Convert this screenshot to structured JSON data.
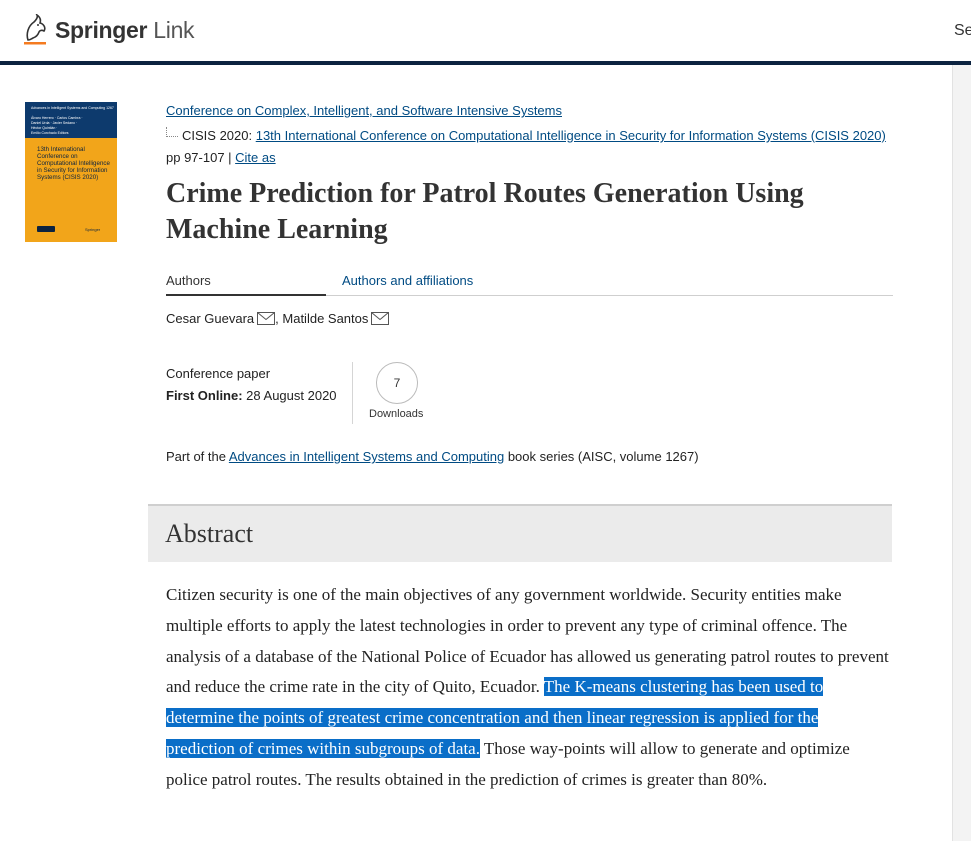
{
  "header": {
    "logo": {
      "brand": "Springer",
      "product": "Link"
    },
    "cut_text": "Se"
  },
  "cover": {
    "series_line": "Advances in Intelligent Systems and Computing 1267",
    "editors": [
      "Álvaro Herrero · Carlos Cambra ·",
      "Daniel Urda · Javier Sedano ·",
      "Héctor Quintián ·",
      "Emilio Corchado  Editors"
    ],
    "title": "13th International Conference on Computational Intelligence in Security for Information Systems (CISIS 2020)",
    "publisher": "Springer"
  },
  "breadcrumb": {
    "conference": "Conference on Complex, Intelligent, and Software Intensive Systems",
    "proceedings_prefix": "CISIS 2020: ",
    "proceedings_link": "13th International Conference on Computational Intelligence in Security for Information Systems (CISIS 2020)",
    "pages": " pp 97-107 | ",
    "cite_as": "Cite as"
  },
  "title": "Crime Prediction for Patrol Routes Generation Using Machine Learning",
  "tabs": [
    {
      "label": "Authors",
      "active": true
    },
    {
      "label": "Authors and affiliations",
      "active": false
    }
  ],
  "authors": [
    {
      "name": "Cesar Guevara"
    },
    {
      "name": "Matilde Santos"
    }
  ],
  "meta": {
    "type": "Conference paper",
    "first_online_label": "First Online:",
    "first_online_value": " 28 August 2020",
    "downloads_count": "7",
    "downloads_label": "Downloads"
  },
  "series": {
    "prefix": "Part of the ",
    "link": "Advances in Intelligent Systems and Computing",
    "suffix": " book series (AISC, volume 1267)"
  },
  "abstract": {
    "heading": "Abstract",
    "text_before": "Citizen security is one of the main objectives of any government worldwide. Security entities make multiple efforts to apply the latest technologies in order to prevent any type of criminal offence. The analysis of a database of the National Police of Ecuador has allowed us generating patrol routes to prevent and reduce the crime rate in the city of Quito, Ecuador. ",
    "text_highlighted": "The K-means clustering has been used to determine the points of greatest crime concentration and then linear regression is applied for the prediction of crimes within subgroups of data.",
    "text_after": " Those way-points will allow to generate and optimize police patrol routes. The results obtained in the prediction of crimes is greater than 80%."
  },
  "colors": {
    "link": "#004b83",
    "navy_rule": "#0c2340",
    "highlight": "#0a6ec8",
    "cover_band": "#f2a51a"
  }
}
